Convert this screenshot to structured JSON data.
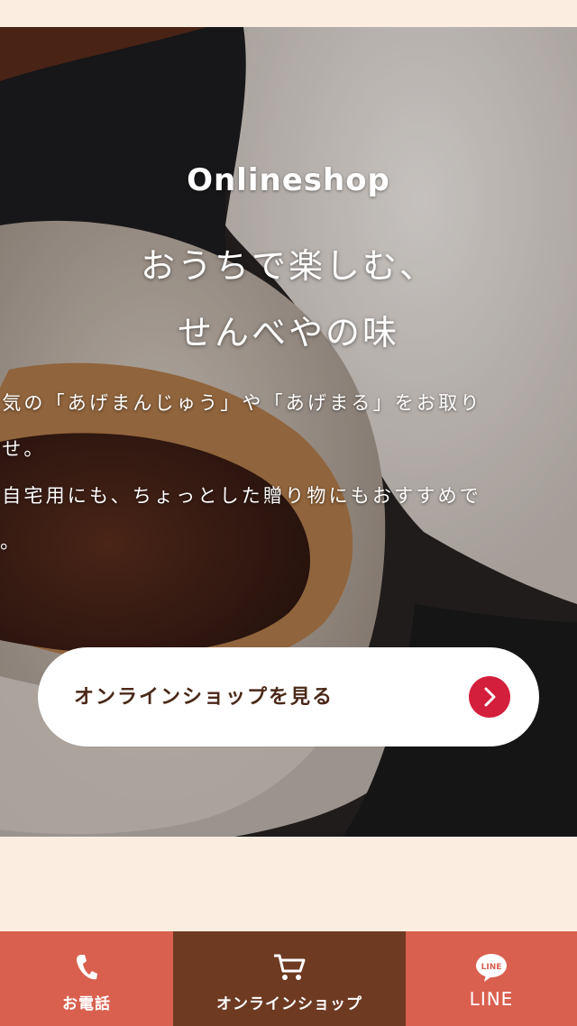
{
  "hero": {
    "brand": "Onlineshop",
    "headline_line1": "おうちで楽しむ、",
    "headline_line2": "せんべやの味",
    "desc_lines": [
      "人気の「あげまんじゅう」や「あげまる」をお取り",
      "寄せ。",
      "ご自宅用にも、ちょっとした贈り物にもおすすめで",
      "す。"
    ]
  },
  "cta": {
    "label": "オンラインショップを見る",
    "icon": "chevron-right-icon",
    "accent_color": "#d31f3c"
  },
  "bottom_nav": {
    "items": [
      {
        "label": "お電話",
        "icon": "phone-icon",
        "color": "#d9604f"
      },
      {
        "label": "オンラインショップ",
        "icon": "cart-icon",
        "color": "#6e3a22"
      },
      {
        "label": "LINE",
        "icon": "line-icon",
        "icon_text": "LINE",
        "color": "#d9604f"
      }
    ]
  }
}
